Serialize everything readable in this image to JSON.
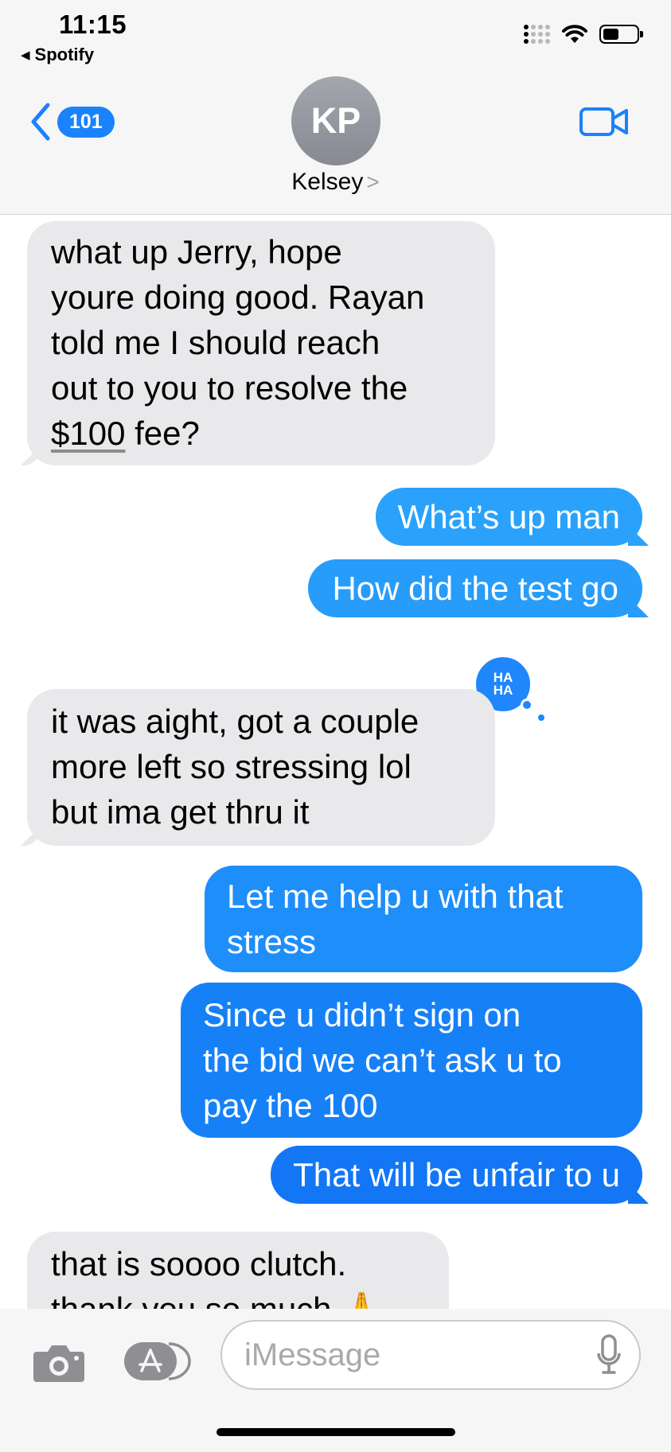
{
  "status_bar": {
    "time": "11:15",
    "back_app": "Spotify"
  },
  "nav": {
    "unread_count": "101",
    "avatar_initials": "KP",
    "contact_name": "Kelsey",
    "contact_chevron": ">"
  },
  "messages": [
    {
      "direction": "received",
      "text_before": "what up Jerry, hope\nyoure doing good. Rayan\ntold me I should reach\nout to you to resolve the\n",
      "link": "$100",
      "text_after": " fee?"
    },
    {
      "direction": "sent",
      "text": "What’s up man"
    },
    {
      "direction": "sent",
      "text": "How did the test go",
      "reaction": "HA HA"
    },
    {
      "direction": "received",
      "text": "it was aight, got a couple\nmore left so stressing lol\nbut ima get thru it"
    },
    {
      "direction": "sent",
      "text": "Let me help u with that\nstress"
    },
    {
      "direction": "sent",
      "text": "Since u didn’t sign on\nthe bid we can’t ask u to\npay the 100"
    },
    {
      "direction": "sent",
      "text": "That will be unfair to u"
    },
    {
      "direction": "received",
      "text": "that is soooo clutch.\nthank you so much 🙏"
    }
  ],
  "reaction_label": {
    "line1": "HA",
    "line2": "HA"
  },
  "input": {
    "placeholder": "iMessage",
    "value": ""
  },
  "colors": {
    "accent": "#1a82fb",
    "received_bubble": "#e9e9eb",
    "sent_gradient_top": "#2aa3fb",
    "sent_gradient_bottom": "#1172f4"
  }
}
